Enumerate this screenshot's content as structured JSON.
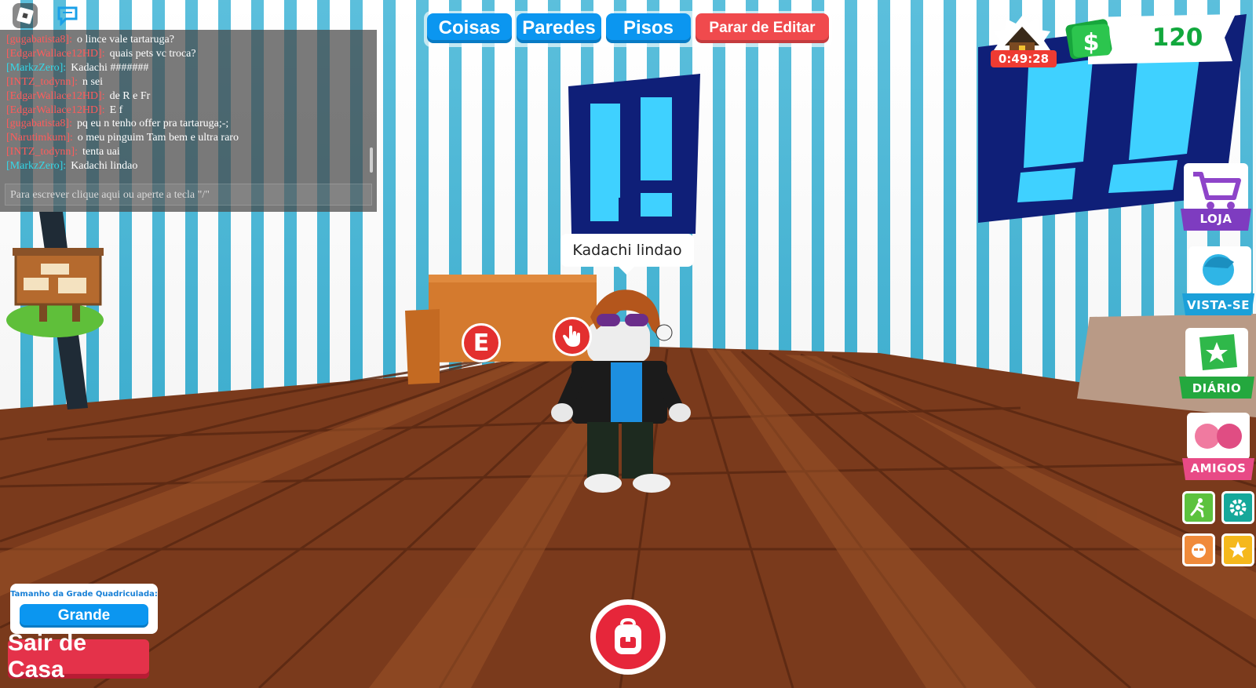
{
  "chat": {
    "messages": [
      {
        "name": "[gugabatista8]:",
        "text": "o lince vale tartaruga?",
        "color": "#ff5b5b"
      },
      {
        "name": "[EdgarWallace12HD]:",
        "text": "quais pets vc troca?",
        "color": "#ff5b5b"
      },
      {
        "name": "[MarkzZero]:",
        "text": "Kadachi #######",
        "color": "#35d8e8"
      },
      {
        "name": "[INTZ_todynn]:",
        "text": "n sei",
        "color": "#ff5b5b"
      },
      {
        "name": "[EdgarWallace12HD]:",
        "text": "de R e Fr",
        "color": "#ff5b5b"
      },
      {
        "name": "[EdgarWallace12HD]:",
        "text": "E f",
        "color": "#ff5b5b"
      },
      {
        "name": "[gugabatista8]:",
        "text": "pq eu n tenho offer pra tartaruga;-;",
        "color": "#ff5b5b"
      },
      {
        "name": "[Narutimkum]:",
        "text": "o meu pinguim Tam bem e ultra raro",
        "color": "#ff5b5b"
      },
      {
        "name": "[INTZ_todynn]:",
        "text": "tenta uai",
        "color": "#ff5b5b"
      },
      {
        "name": "[MarkzZero]:",
        "text": "Kadachi lindao",
        "color": "#35d8e8"
      }
    ],
    "input_placeholder": "Para escrever clique aqui ou aperte a tecla \"/\""
  },
  "edit_bar": {
    "things": "Coisas",
    "walls": "Paredes",
    "floors": "Pisos",
    "stop": "Parar de Editar"
  },
  "status": {
    "timer": "0:49:28",
    "money": "120"
  },
  "side_menu": {
    "shop": "LOJA",
    "dress": "VISTA-SE",
    "journal": "DIÁRIO",
    "friends": "AMIGOS"
  },
  "speech_bubble": "Kadachi lindao",
  "prompts": {
    "e_key": "E"
  },
  "grid": {
    "title": "Tamanho da Grade Quadriculada:",
    "value": "Grande"
  },
  "exit_button": "Sair de Casa",
  "colors": {
    "blue_button": "#0b96f0",
    "red_button": "#f04a4d",
    "money_green": "#12a83d",
    "wall_stripe": "#3fb4d6"
  }
}
